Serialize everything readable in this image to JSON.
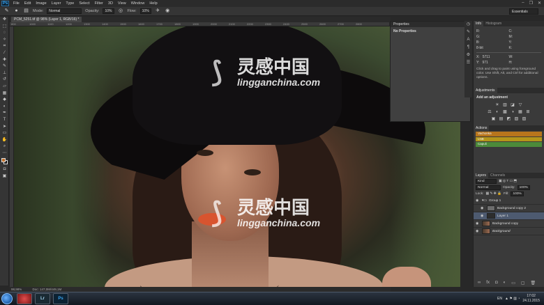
{
  "menubar": {
    "logo": "Ps",
    "items": [
      "File",
      "Edit",
      "Image",
      "Layer",
      "Type",
      "Select",
      "Filter",
      "3D",
      "View",
      "Window",
      "Help"
    ],
    "window_controls": [
      "–",
      "❐",
      "✕"
    ]
  },
  "options_bar": {
    "mode_label": "Mode:",
    "mode_value": "Normal",
    "opacity_label": "Opacity:",
    "opacity_value": "10%",
    "flow_label": "Flow:",
    "flow_value": "10%",
    "workspace": "Essentials"
  },
  "document": {
    "tab_label": "PCM_5251.tif @ 98% (Layer 1, RGB/16) *",
    "ruler_ticks": [
      "800",
      "1000",
      "1100",
      "1200",
      "1300",
      "1400",
      "1500",
      "1600",
      "1700",
      "1800",
      "1900",
      "2000",
      "2100",
      "2200",
      "2300",
      "2400",
      "2500",
      "2600",
      "2700",
      "2800"
    ],
    "zoom": "98,98%",
    "doc_size": "Doc: 147,0M/449,1M"
  },
  "watermark": {
    "cn": "灵感中国",
    "en": "lingganchina.com"
  },
  "properties_panel": {
    "title": "Properties",
    "body": "No Properties"
  },
  "info_panel": {
    "tabs": [
      "Info",
      "Histogram"
    ],
    "r": "R:",
    "g": "G:",
    "b": "B:",
    "bits": "8-bit",
    "c": "C:",
    "m": "M:",
    "y": "Y:",
    "k": "K:",
    "x_label": "X:",
    "x_value": "5711",
    "y_label": "Y:",
    "y_value": "971",
    "w_label": "W:",
    "h_label": "H:",
    "description": "Click and drag to paint using foreground color. Use Shift, Alt, and Ctrl for additional options."
  },
  "adjustments": {
    "tab": "Adjustments",
    "title": "Add an adjustment",
    "row1": [
      "☀",
      "▥",
      "◪",
      "▽"
    ],
    "row2": [
      "⚖",
      "◐",
      "▩",
      "◑",
      "▦",
      "⊞"
    ],
    "row3": [
      "▣",
      "▤",
      "◩",
      "▧",
      "▨"
    ]
  },
  "actions": {
    "tab": "Actions",
    "items": [
      {
        "label": "Vachonka",
        "color": "#b8751c"
      },
      {
        "label": "LNB",
        "color": "#b4951a"
      },
      {
        "label": "Capuli",
        "color": "#4c8a3a"
      }
    ]
  },
  "layers_panel": {
    "tabs": [
      "Layers",
      "Channels"
    ],
    "kind_label": "Kind",
    "blend_mode": "Normal",
    "opacity_label": "Opacity:",
    "opacity_value": "100%",
    "lock_label": "Lock:",
    "fill_label": "Fill:",
    "fill_value": "100%",
    "layers": [
      {
        "name": "Group 1",
        "type": "group"
      },
      {
        "name": "Background copy 2",
        "type": "normal"
      },
      {
        "name": "Layer 1",
        "type": "selected"
      },
      {
        "name": "Background copy",
        "type": "photo"
      },
      {
        "name": "Background",
        "type": "photo"
      }
    ]
  },
  "taskbar": {
    "apps": [
      "",
      "Lr",
      "Ps"
    ],
    "lang": "EN",
    "time": "17:02",
    "date": "24.11.2015"
  },
  "colors": {
    "foreground": "#c1702a",
    "background": "#111111"
  }
}
